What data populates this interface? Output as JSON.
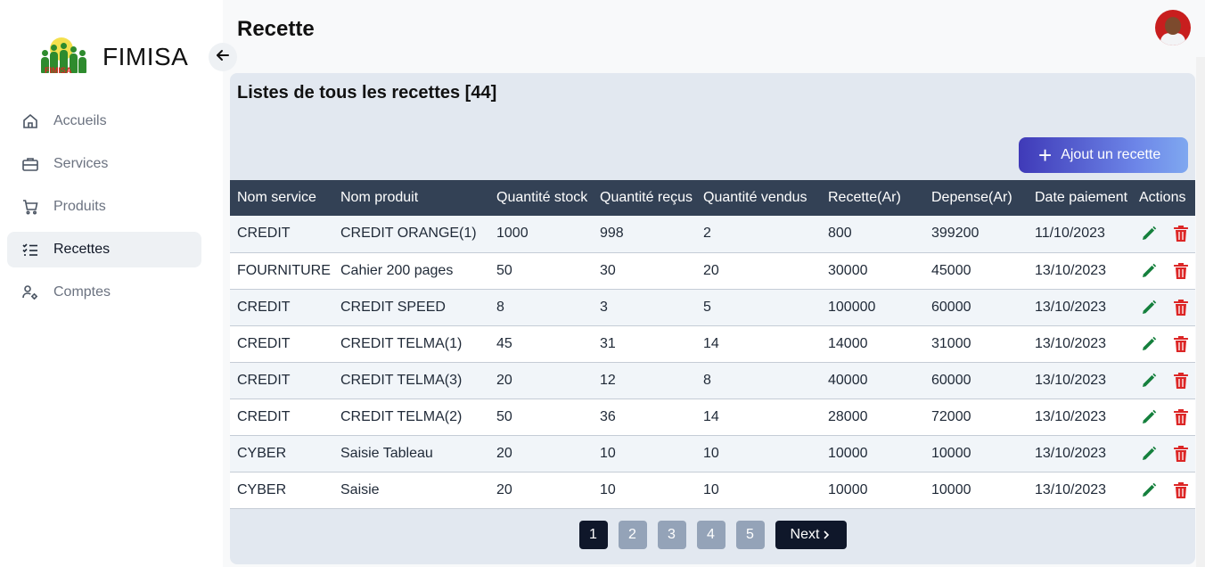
{
  "brand": {
    "name": "FIMISA",
    "logo_text": "FIMISA"
  },
  "nav": [
    {
      "label": "Accueils",
      "icon": "home-icon"
    },
    {
      "label": "Services",
      "icon": "briefcase-icon"
    },
    {
      "label": "Produits",
      "icon": "cart-icon"
    },
    {
      "label": "Recettes",
      "icon": "checklist-icon",
      "active": true
    },
    {
      "label": "Comptes",
      "icon": "users-gear-icon"
    }
  ],
  "header": {
    "title": "Recette"
  },
  "card": {
    "title": "Listes de tous les recettes [44]",
    "add_label": "Ajout un recette"
  },
  "table": {
    "columns": [
      "Nom service",
      "Nom produit",
      "Quantité stock",
      "Quantité reçus",
      "Quantité vendus",
      "Recette(Ar)",
      "Depense(Ar)",
      "Date paiement",
      "Actions"
    ],
    "rows": [
      [
        "CREDIT",
        "CREDIT ORANGE(1)",
        "1000",
        "998",
        "2",
        "800",
        "399200",
        "11/10/2023"
      ],
      [
        "FOURNITURE",
        "Cahier 200 pages",
        "50",
        "30",
        "20",
        "30000",
        "45000",
        "13/10/2023"
      ],
      [
        "CREDIT",
        "CREDIT SPEED",
        "8",
        "3",
        "5",
        "100000",
        "60000",
        "13/10/2023"
      ],
      [
        "CREDIT",
        "CREDIT TELMA(1)",
        "45",
        "31",
        "14",
        "14000",
        "31000",
        "13/10/2023"
      ],
      [
        "CREDIT",
        "CREDIT TELMA(3)",
        "20",
        "12",
        "8",
        "40000",
        "60000",
        "13/10/2023"
      ],
      [
        "CREDIT",
        "CREDIT TELMA(2)",
        "50",
        "36",
        "14",
        "28000",
        "72000",
        "13/10/2023"
      ],
      [
        "CYBER",
        "Saisie Tableau",
        "20",
        "10",
        "10",
        "10000",
        "10000",
        "13/10/2023"
      ],
      [
        "CYBER",
        "Saisie",
        "20",
        "10",
        "10",
        "10000",
        "10000",
        "13/10/2023"
      ]
    ]
  },
  "pagination": {
    "pages": [
      "1",
      "2",
      "3",
      "4",
      "5"
    ],
    "current": "1",
    "next_label": "Next"
  },
  "colors": {
    "header_row": "#334155",
    "edit": "#15803d",
    "delete": "#dc2626",
    "accent": "#3f3ab8"
  }
}
